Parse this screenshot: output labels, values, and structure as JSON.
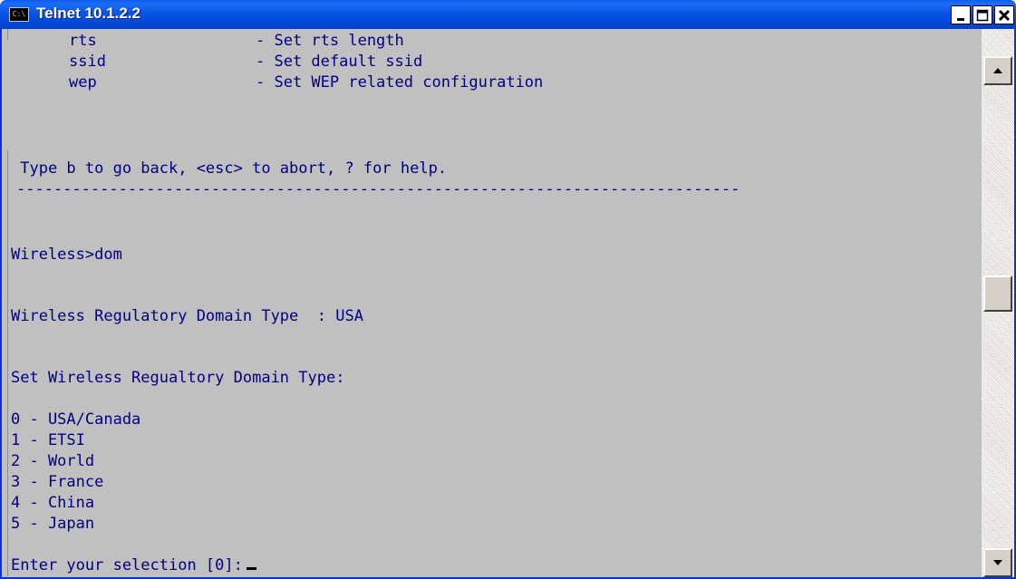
{
  "window": {
    "title": "Telnet 10.1.2.2",
    "icon": "console-icon",
    "icon_text": "C:\\",
    "controls": [
      "minimize-icon",
      "maximize-icon",
      "close-icon"
    ]
  },
  "terminal": {
    "menu_items": [
      {
        "name": "rts",
        "description": "- Set rts length"
      },
      {
        "name": "ssid",
        "description": "- Set default ssid"
      },
      {
        "name": "wep",
        "description": "- Set WEP related configuration"
      }
    ],
    "help_line": " Type b to go back, <esc> to abort, ? for help.",
    "separator": "------------------------------------------------------------------------------",
    "prompt_command": "Wireless>dom",
    "current_domain": "Wireless Regulatory Domain Type  : USA",
    "set_header": "Set Wireless Regualtory Domain Type:",
    "options": [
      "0 - USA/Canada",
      "1 - ETSI",
      "2 - World",
      "3 - France",
      "4 - China",
      "5 - Japan"
    ],
    "selection_prompt": "Enter your selection [0]:"
  },
  "colors": {
    "terminal_background": "#c0c0c0",
    "terminal_text": "#000080",
    "titlebar": "#0a55e4"
  }
}
